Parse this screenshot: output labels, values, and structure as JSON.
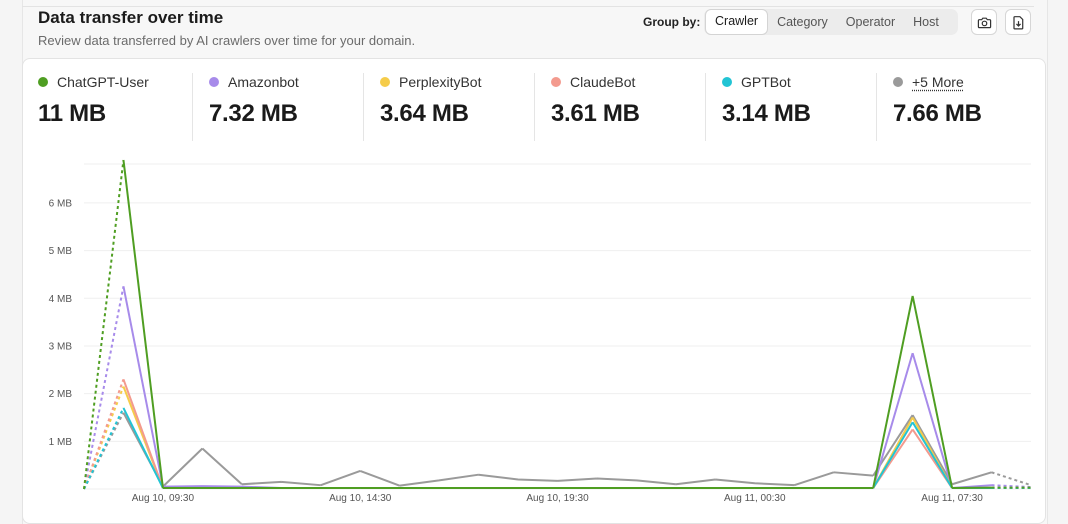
{
  "header": {
    "title": "Data transfer over time",
    "subtitle": "Review data transferred by AI crawlers over time for your domain.",
    "group_by_label": "Group by:",
    "group_options": [
      "Crawler",
      "Category",
      "Operator",
      "Host"
    ],
    "active_group": "Crawler",
    "screenshot_icon": "camera-icon",
    "download_icon": "file-download-icon"
  },
  "stats": [
    {
      "name": "ChatGPT-User",
      "value": "11 MB",
      "color": "#4f9e22"
    },
    {
      "name": "Amazonbot",
      "value": "7.32 MB",
      "color": "#a78bea"
    },
    {
      "name": "PerplexityBot",
      "value": "3.64 MB",
      "color": "#f5cc4a"
    },
    {
      "name": "ClaudeBot",
      "value": "3.61 MB",
      "color": "#f39a8e"
    },
    {
      "name": "GPTBot",
      "value": "3.14 MB",
      "color": "#22c4d4"
    },
    {
      "name": "+5 More",
      "value": "7.66 MB",
      "color": "#9a9a9a"
    }
  ],
  "chart_data": {
    "type": "line",
    "y_unit": "MB",
    "ylim": [
      0,
      6.9
    ],
    "y_ticks": [
      1,
      2,
      3,
      4,
      5,
      6
    ],
    "y_tick_labels": [
      "1 MB",
      "2 MB",
      "3 MB",
      "4 MB",
      "5 MB",
      "6 MB"
    ],
    "x_tick_labels": [
      "Aug 10, 09:30",
      "Aug 10, 14:30",
      "Aug 10, 19:30",
      "Aug 11, 00:30",
      "Aug 11, 07:30"
    ],
    "x_tick_index": [
      2,
      7,
      12,
      17,
      22
    ],
    "x_count": 25,
    "grid": true,
    "dashed_segments": [
      [
        0,
        1
      ],
      [
        23,
        24
      ]
    ],
    "series": [
      {
        "name": "+5 More",
        "color": "#9a9a9a",
        "values": [
          0,
          1.6,
          0.05,
          0.85,
          0.1,
          0.15,
          0.08,
          0.38,
          0.07,
          0.18,
          0.3,
          0.2,
          0.17,
          0.22,
          0.18,
          0.1,
          0.2,
          0.12,
          0.08,
          0.35,
          0.28,
          1.55,
          0.1,
          0.35,
          0.08
        ]
      },
      {
        "name": "Amazonbot",
        "color": "#a78bea",
        "values": [
          0,
          4.25,
          0.05,
          0.06,
          0.05,
          0.02,
          0.02,
          0.02,
          0.02,
          0.02,
          0.02,
          0.02,
          0.02,
          0.02,
          0.02,
          0.02,
          0.02,
          0.02,
          0.02,
          0.02,
          0.02,
          2.85,
          0.02,
          0.08,
          0.04
        ]
      },
      {
        "name": "PerplexityBot",
        "color": "#f5cc4a",
        "values": [
          0,
          2.15,
          0.02,
          0.02,
          0.02,
          0.02,
          0.02,
          0.02,
          0.02,
          0.02,
          0.02,
          0.02,
          0.02,
          0.02,
          0.02,
          0.02,
          0.02,
          0.02,
          0.02,
          0.02,
          0.02,
          1.5,
          0.02,
          0.02,
          0.02
        ]
      },
      {
        "name": "ClaudeBot",
        "color": "#f39a8e",
        "values": [
          0,
          2.3,
          0.02,
          0.02,
          0.02,
          0.02,
          0.02,
          0.02,
          0.02,
          0.02,
          0.02,
          0.02,
          0.02,
          0.02,
          0.02,
          0.02,
          0.02,
          0.02,
          0.02,
          0.02,
          0.02,
          1.25,
          0.02,
          0.02,
          0.02
        ]
      },
      {
        "name": "GPTBot",
        "color": "#22c4d4",
        "values": [
          0,
          1.7,
          0.02,
          0.02,
          0.02,
          0.02,
          0.02,
          0.02,
          0.02,
          0.02,
          0.02,
          0.02,
          0.02,
          0.02,
          0.02,
          0.02,
          0.02,
          0.02,
          0.02,
          0.02,
          0.02,
          1.4,
          0.02,
          0.02,
          0.02
        ]
      },
      {
        "name": "ChatGPT-User",
        "color": "#4f9e22",
        "values": [
          0,
          6.9,
          0.02,
          0.02,
          0.02,
          0.02,
          0.02,
          0.02,
          0.02,
          0.02,
          0.02,
          0.02,
          0.02,
          0.02,
          0.02,
          0.02,
          0.02,
          0.02,
          0.02,
          0.02,
          0.02,
          4.05,
          0.02,
          0.03,
          0.03
        ]
      }
    ]
  }
}
